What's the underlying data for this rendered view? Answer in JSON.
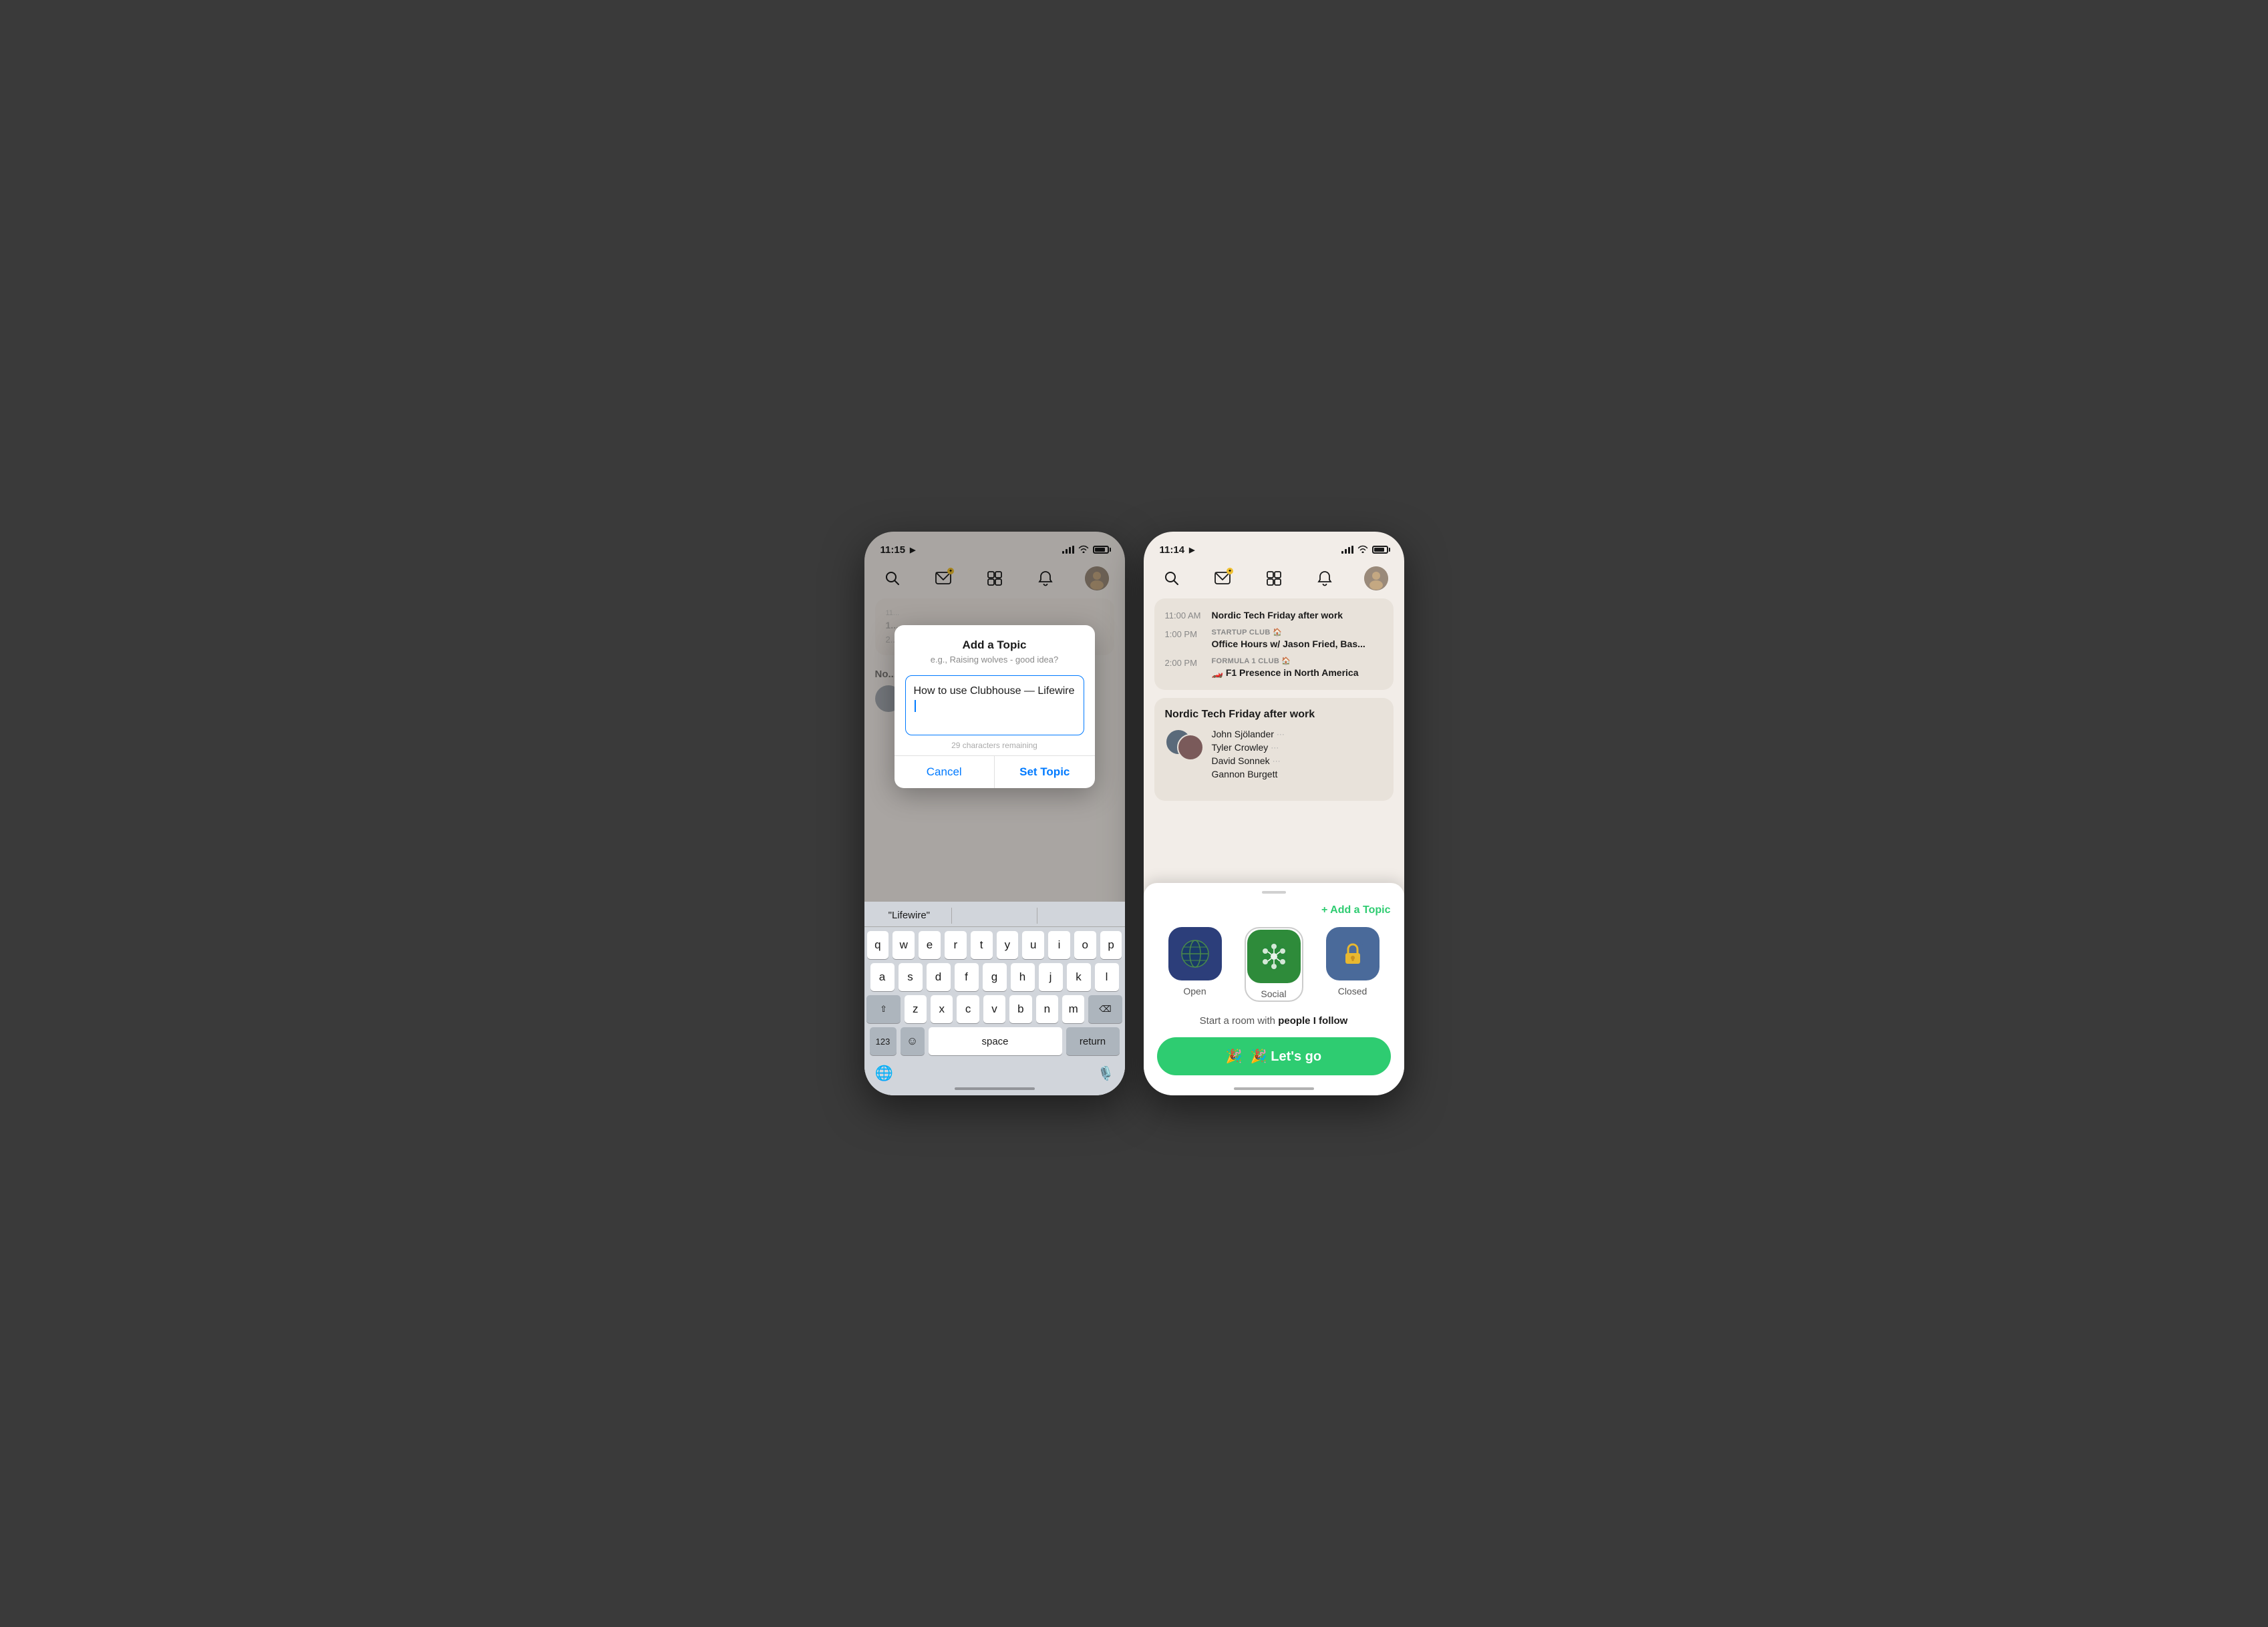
{
  "phone1": {
    "statusBar": {
      "time": "11:15",
      "hasLocation": true
    },
    "modal": {
      "title": "Add a Topic",
      "subtitle": "e.g., Raising wolves - good idea?",
      "inputText": "How to use Clubhouse — Lifewire",
      "charCount": "29 characters remaining",
      "cancelLabel": "Cancel",
      "setTopicLabel": "Set Topic"
    },
    "keyboard": {
      "suggestion": "\"Lifewire\"",
      "rows": [
        [
          "q",
          "w",
          "e",
          "r",
          "t",
          "y",
          "u",
          "i",
          "o",
          "p"
        ],
        [
          "a",
          "s",
          "d",
          "f",
          "g",
          "h",
          "j",
          "k",
          "l"
        ],
        [
          "z",
          "x",
          "c",
          "v",
          "b",
          "n",
          "m"
        ],
        []
      ],
      "spaceLabel": "space",
      "returnLabel": "return",
      "numberLabel": "123",
      "shiftLabel": "⇧",
      "deleteLabel": "⌫"
    }
  },
  "phone2": {
    "statusBar": {
      "time": "11:14",
      "hasLocation": true
    },
    "schedule": {
      "items": [
        {
          "time": "11:00 AM",
          "title": "Nordic Tech Friday after work",
          "club": null
        },
        {
          "time": "1:00 PM",
          "clubLabel": "STARTUP CLUB 🏠",
          "title": "Office Hours w/ Jason Fried, Bas...",
          "club": "startup"
        },
        {
          "time": "2:00 PM",
          "clubLabel": "FORMULA 1 CLUB 🏠",
          "title": "🏎️ F1 Presence in North America",
          "club": "formula"
        }
      ]
    },
    "roomCard": {
      "title": "Nordic Tech Friday after work",
      "members": [
        {
          "name": "John Sjölander",
          "speaking": true
        },
        {
          "name": "Tyler Crowley",
          "speaking": true
        },
        {
          "name": "David Sonnek",
          "speaking": true
        },
        {
          "name": "Gannon Burgett",
          "speaking": false
        }
      ]
    },
    "bottomSheet": {
      "addTopicLabel": "+ Add a Topic",
      "roomTypes": [
        {
          "id": "open",
          "label": "Open",
          "emoji": "🌍"
        },
        {
          "id": "social",
          "label": "Social",
          "emoji": "✳️"
        },
        {
          "id": "closed",
          "label": "Closed",
          "emoji": "🔒"
        }
      ],
      "selectedType": "social",
      "startRoomDesc": "Start a room with people I follow",
      "letsGoLabel": "🎉 Let's go"
    }
  }
}
